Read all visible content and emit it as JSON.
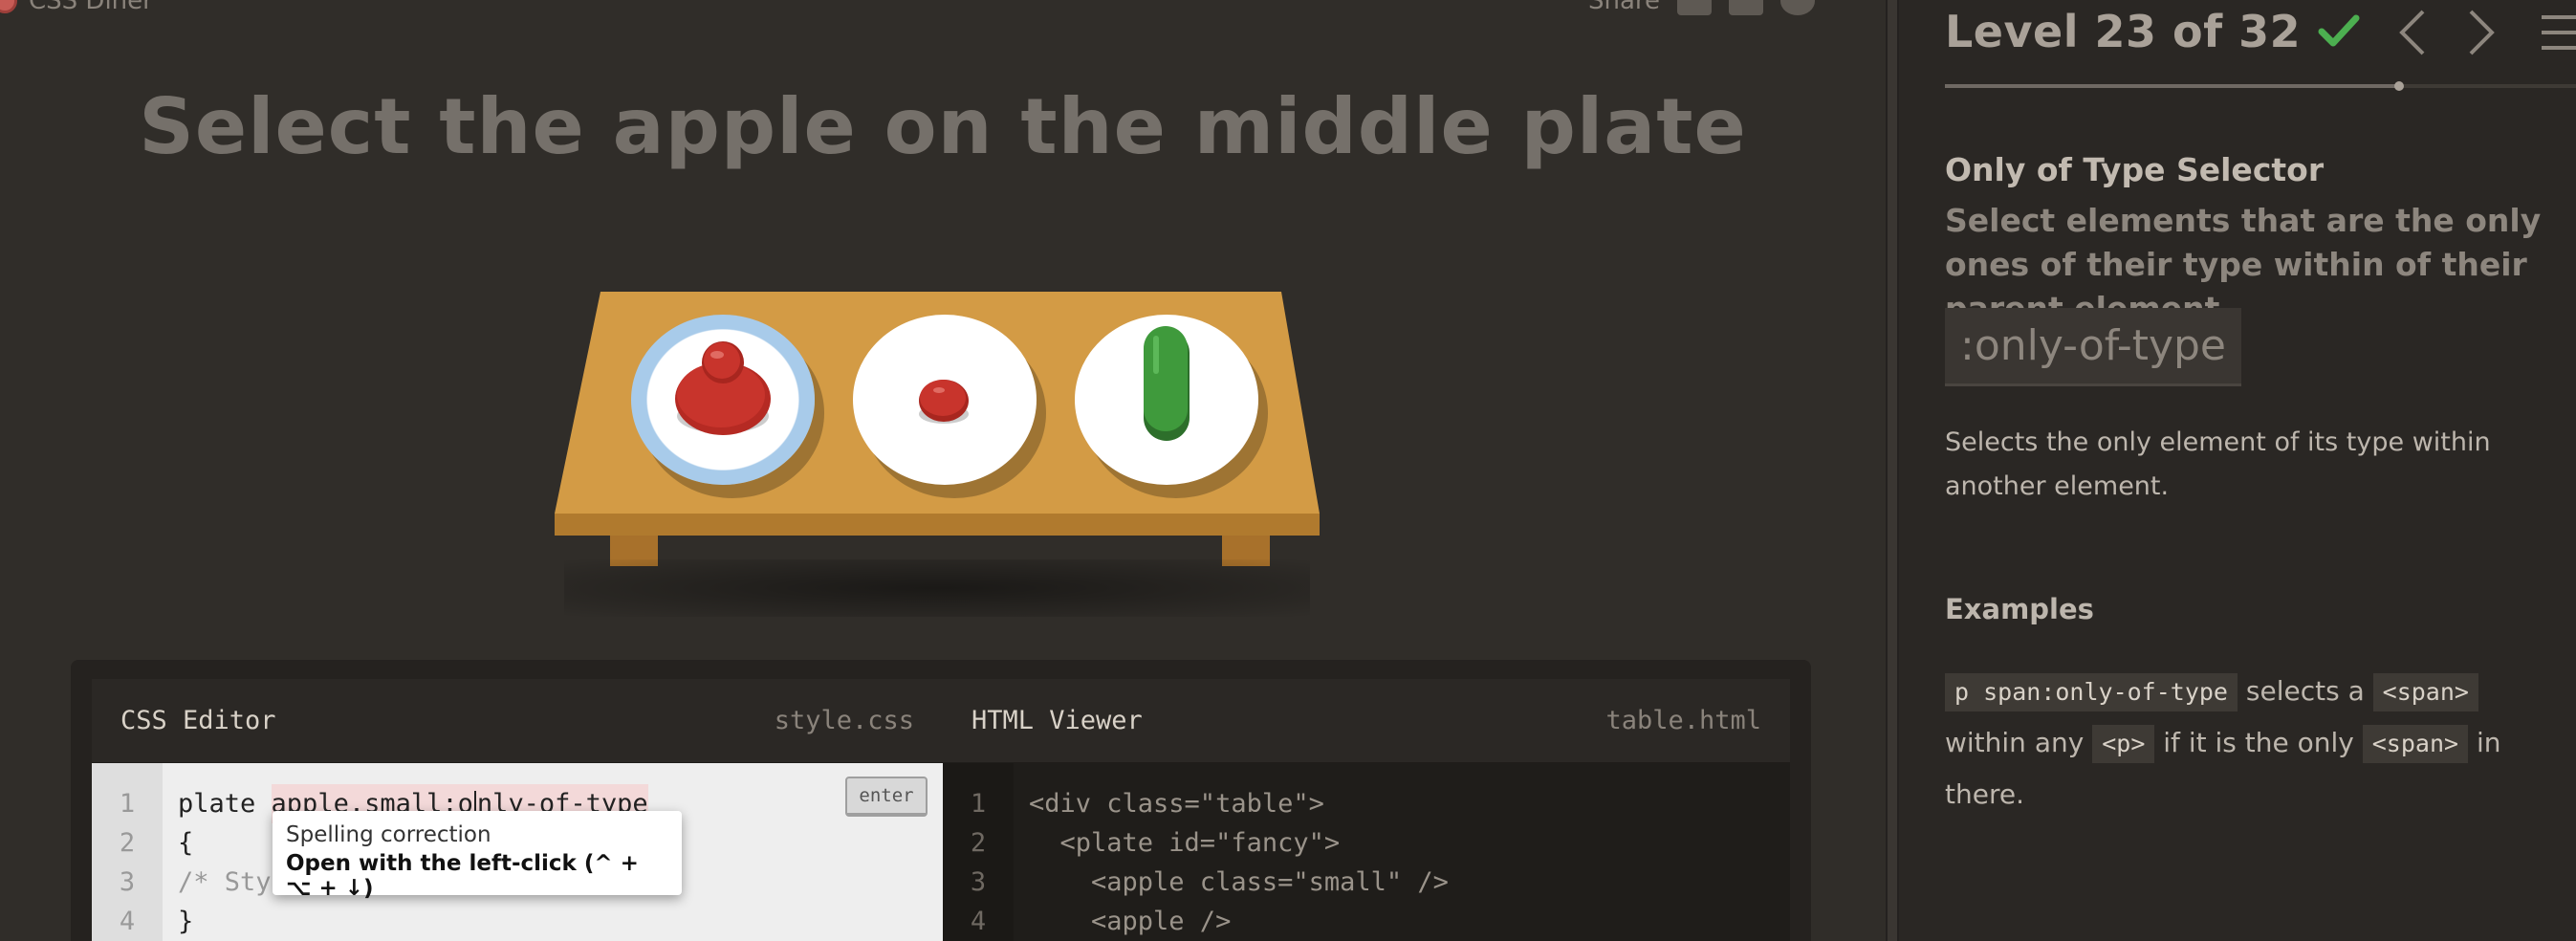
{
  "app": {
    "logo_text": "CSS Diner",
    "share_label": "Share"
  },
  "level": {
    "title": "Level 23 of 32",
    "completed": true,
    "progress_fraction": 0.72
  },
  "order": "Select the apple on the middle plate",
  "table": {
    "plates": [
      {
        "id": "fancy",
        "contents": "apple"
      },
      {
        "id": "",
        "contents": "apple small"
      },
      {
        "id": "",
        "contents": "pickle"
      }
    ]
  },
  "css_editor": {
    "title": "CSS Editor",
    "file": "style.css",
    "enter_label": "enter",
    "line_numbers": [
      "1",
      "2",
      "3",
      "4"
    ],
    "input_prefix": "plate ",
    "input_typed_before_caret": "apple.small:o",
    "input_typed_after_caret": "nly-of-type",
    "line2": "{",
    "line3": "/* Sty",
    "line4": "}"
  },
  "html_viewer": {
    "title": "HTML Viewer",
    "file": "table.html",
    "line_numbers": [
      "1",
      "2",
      "3",
      "4"
    ],
    "lines": [
      "<div class=\"table\">",
      "  <plate id=\"fancy\">",
      "    <apple class=\"small\" />",
      "    <apple />"
    ]
  },
  "tooltip": {
    "title": "Spelling correction",
    "body": "Open with the left-click (^ + ⌥ + ↓)"
  },
  "sidebar": {
    "selector_name": "Only of Type Selector",
    "selector_title": "Select elements that are the only ones of their type within of their parent element",
    "syntax": ":only-of-type",
    "hint": "Selects the only element of its type within another element.",
    "examples_title": "Examples",
    "example": {
      "code1": "p span:only-of-type",
      "text1": "selects a",
      "code2": "<span>",
      "text2": "within any",
      "code3": "<p>",
      "text3": "if it is the only",
      "code4": "<span>",
      "text4": "in there."
    }
  },
  "colors": {
    "apple_red": "#c8342c",
    "pickle_green": "#3f9a3c",
    "table_wood": "#d39b45",
    "check_green": "#4caf50"
  }
}
